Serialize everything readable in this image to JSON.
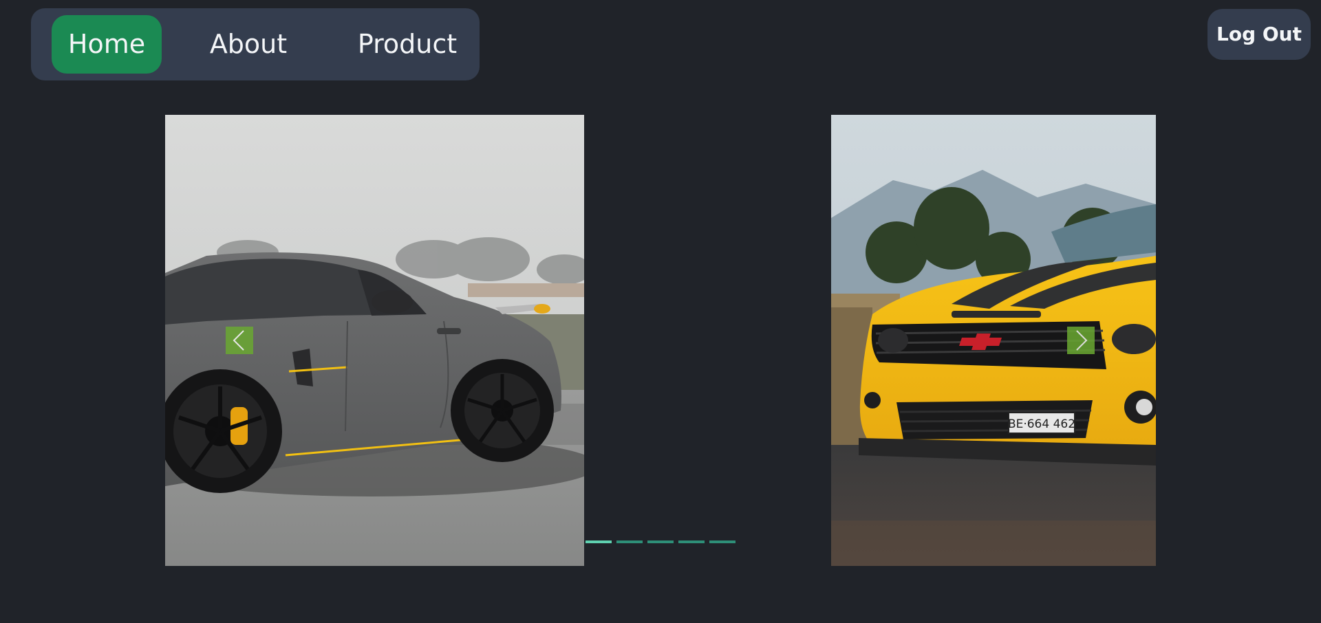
{
  "nav": {
    "items": [
      {
        "label": "Home",
        "active": true
      },
      {
        "label": "About",
        "active": false
      },
      {
        "label": "Product",
        "active": false
      }
    ],
    "active_color": "#1b8a53",
    "background_color": "#343d4e"
  },
  "header": {
    "logout_label": "Log Out"
  },
  "carousel": {
    "slides": [
      {
        "subject": "grey sports car"
      },
      {
        "subject": "yellow muscle car",
        "plate_text": "BE·664 462"
      }
    ],
    "prev_icon": "chevron-left-icon",
    "next_icon": "chevron-right-icon",
    "indicator_count": 5,
    "active_indicator": 1,
    "indicator_color": "#2e8f78",
    "indicator_active_color": "#5fd1b0",
    "arrow_color": "#6aa832"
  },
  "page": {
    "background_color": "#202329"
  }
}
